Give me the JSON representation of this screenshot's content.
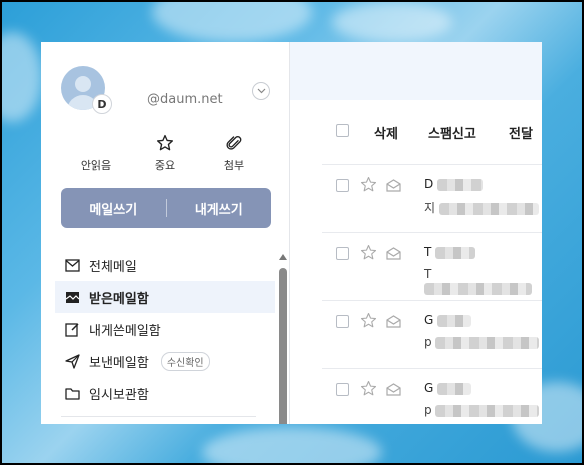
{
  "account": {
    "avatar_letter": "D",
    "email_domain": "@daum.net"
  },
  "quick_links": [
    {
      "label": "안읽음",
      "icon": "unread-mail-icon"
    },
    {
      "label": "중요",
      "icon": "star-icon"
    },
    {
      "label": "첨부",
      "icon": "paperclip-icon"
    }
  ],
  "compose": {
    "write_label": "메일쓰기",
    "self_label": "내게쓰기"
  },
  "folders": [
    {
      "label": "전체메일",
      "icon": "mail-icon"
    },
    {
      "label": "받은메일함",
      "icon": "inbox-icon",
      "active": true
    },
    {
      "label": "내게쓴메일함",
      "icon": "note-edit-icon"
    },
    {
      "label": "보낸메일함",
      "icon": "send-icon",
      "badge": "수신확인"
    },
    {
      "label": "임시보관함",
      "icon": "folder-icon"
    }
  ],
  "toolbar": {
    "delete_label": "삭제",
    "spam_label": "스팸신고",
    "forward_label": "전달"
  },
  "messages": [
    {
      "sender_initial": "D",
      "subject_initial": "지"
    },
    {
      "sender_initial": "T",
      "subject_initial": "T"
    },
    {
      "sender_initial": "G",
      "subject_initial": "p"
    },
    {
      "sender_initial": "G",
      "subject_initial": "p"
    }
  ],
  "colors": {
    "compose_bar": "#8594b6",
    "active_folder_bg": "#eef3fb",
    "header_bg": "#f1f6fd",
    "desktop_sky": "#2c9fd8"
  }
}
